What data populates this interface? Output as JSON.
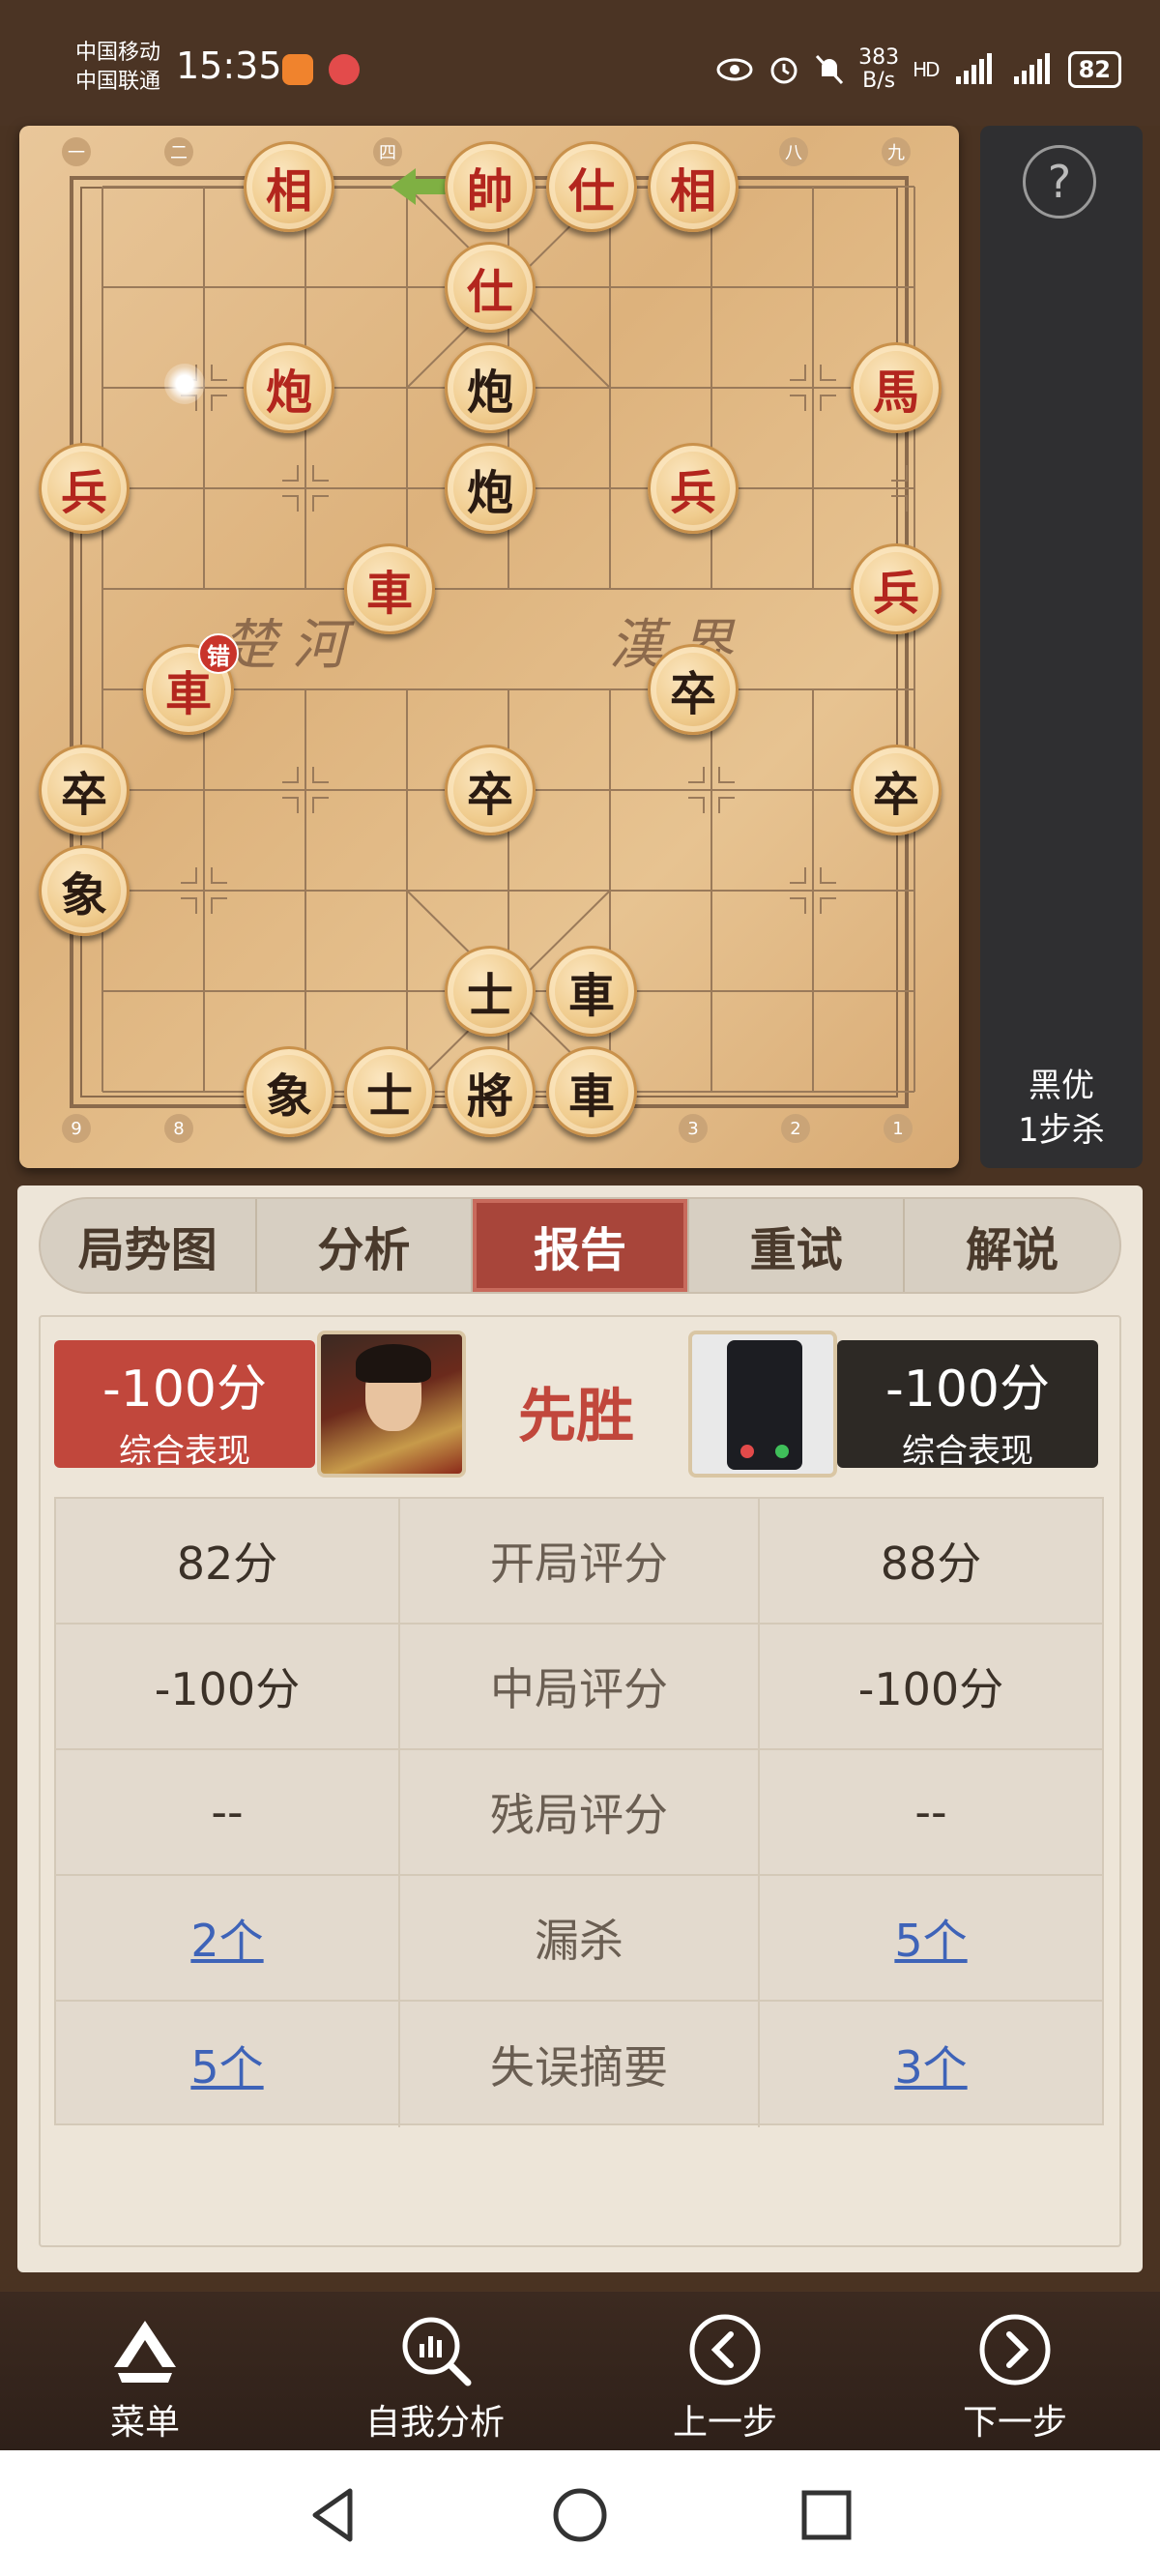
{
  "status_bar": {
    "carrier_1": "中国移动",
    "carrier_2": "中国联通",
    "time": "15:35",
    "net_speed_value": "383",
    "net_speed_unit": "B/s",
    "battery": "82",
    "icons": [
      "eye-icon",
      "alarm-icon",
      "mute-icon",
      "hd-icon",
      "signal-5g-icon",
      "signal-4g-icon"
    ]
  },
  "board": {
    "top_coords": [
      "一",
      "二",
      "四",
      "八",
      "九"
    ],
    "bottom_coords": [
      "9",
      "8",
      "3",
      "2",
      "1"
    ],
    "river_left": "楚河",
    "river_right": "漢界",
    "error_badge": "错",
    "pieces": [
      {
        "label": "相",
        "side": "red"
      },
      {
        "label": "帥",
        "side": "red"
      },
      {
        "label": "仕",
        "side": "red"
      },
      {
        "label": "相",
        "side": "red"
      },
      {
        "label": "仕",
        "side": "red"
      },
      {
        "label": "炮",
        "side": "red"
      },
      {
        "label": "炮",
        "side": "black"
      },
      {
        "label": "馬",
        "side": "red"
      },
      {
        "label": "兵",
        "side": "red"
      },
      {
        "label": "炮",
        "side": "black"
      },
      {
        "label": "兵",
        "side": "red"
      },
      {
        "label": "車",
        "side": "red"
      },
      {
        "label": "兵",
        "side": "red"
      },
      {
        "label": "車",
        "side": "red"
      },
      {
        "label": "卒",
        "side": "black"
      },
      {
        "label": "卒",
        "side": "black"
      },
      {
        "label": "卒",
        "side": "black"
      },
      {
        "label": "卒",
        "side": "black"
      },
      {
        "label": "象",
        "side": "black"
      },
      {
        "label": "士",
        "side": "black"
      },
      {
        "label": "車",
        "side": "black"
      },
      {
        "label": "象",
        "side": "black"
      },
      {
        "label": "士",
        "side": "black"
      },
      {
        "label": "將",
        "side": "black"
      },
      {
        "label": "車",
        "side": "black"
      }
    ]
  },
  "side_panel": {
    "help_label": "?",
    "result_line_1": "黑优",
    "result_line_2": "1步杀"
  },
  "tabs": [
    "局势图",
    "分析",
    "报告",
    "重试",
    "解说"
  ],
  "active_tab": "报告",
  "report": {
    "left_score": "-100分",
    "left_score_label": "综合表现",
    "right_score": "-100分",
    "right_score_label": "综合表现",
    "result": "先胜",
    "rows": [
      {
        "left": "82分",
        "label": "开局评分",
        "right": "88分",
        "link": false
      },
      {
        "left": "-100分",
        "label": "中局评分",
        "right": "-100分",
        "link": false
      },
      {
        "left": "--",
        "label": "残局评分",
        "right": "--",
        "link": false
      },
      {
        "left": "2个",
        "label": "漏杀",
        "right": "5个",
        "link": true
      },
      {
        "left": "5个",
        "label": "失误摘要",
        "right": "3个",
        "link": true
      }
    ]
  },
  "bottom_nav": [
    {
      "label": "菜单",
      "icon": "menu-icon"
    },
    {
      "label": "自我分析",
      "icon": "self-analysis-icon"
    },
    {
      "label": "上一步",
      "icon": "previous-step-icon"
    },
    {
      "label": "下一步",
      "icon": "next-step-icon"
    }
  ],
  "colors": {
    "red_piece": "#b3261e",
    "black_piece": "#2a1b12",
    "active_tab": "#a8453a",
    "link": "#3e63b8",
    "win": "#c1473c"
  }
}
